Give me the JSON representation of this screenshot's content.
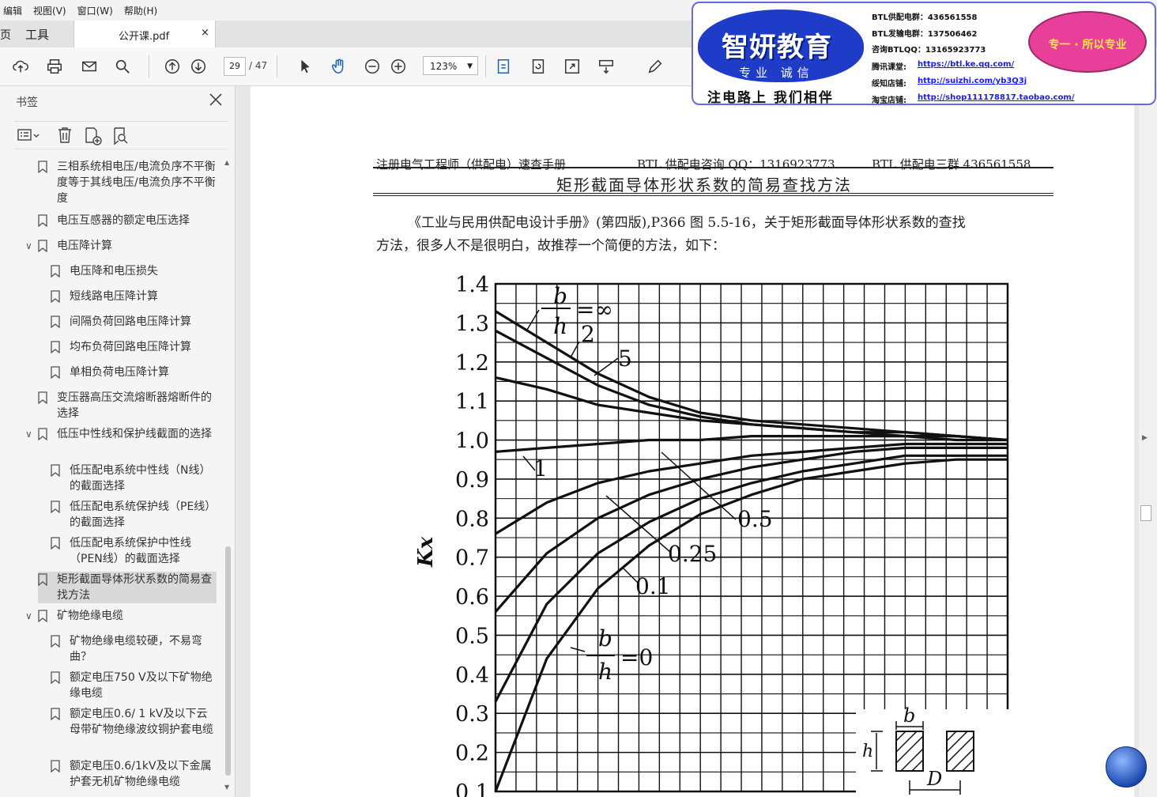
{
  "menu": [
    "编辑",
    "视图(V)",
    "窗口(W)",
    "帮助(H)"
  ],
  "tabs": {
    "cut_label": "页",
    "tools_label": "工具",
    "file_name": "公开课.pdf",
    "close_glyph": "×"
  },
  "toolbar": {
    "page_current": "29",
    "page_total": "/ 47",
    "zoom": "123%",
    "icons": [
      "upload-icon",
      "print-icon",
      "mail-icon",
      "search-icon",
      "page-up-icon",
      "page-down-icon",
      "select-cursor-icon",
      "hand-tool-icon",
      "zoom-out-icon",
      "zoom-in-icon",
      "fit-page-icon",
      "rotate-icon",
      "fullscreen-icon",
      "read-mode-icon",
      "pen-icon"
    ]
  },
  "sidebar": {
    "title": "书签",
    "bookmarks": [
      {
        "label": "三相系统相电压/电流负序不平衡度等于其线电压/电流负序不平衡度",
        "level": 1,
        "expand": ""
      },
      {
        "label": "电压互感器的额定电压选择",
        "level": 1,
        "expand": ""
      },
      {
        "label": "电压降计算",
        "level": 1,
        "expand": "∨"
      },
      {
        "label": "电压降和电压损失",
        "level": 2,
        "expand": ""
      },
      {
        "label": "短线路电压降计算",
        "level": 2,
        "expand": ""
      },
      {
        "label": "间隔负荷回路电压降计算",
        "level": 2,
        "expand": ""
      },
      {
        "label": "均布负荷回路电压降计算",
        "level": 2,
        "expand": ""
      },
      {
        "label": "单相负荷电压降计算",
        "level": 2,
        "expand": ""
      },
      {
        "label": "变压器高压交流熔断器熔断件的选择",
        "level": 1,
        "expand": ""
      },
      {
        "label": "低压中性线和保护线截面的选择",
        "level": 1,
        "expand": "∨"
      },
      {
        "label": "低压配电系统中性线（N线）的截面选择",
        "level": 2,
        "expand": ""
      },
      {
        "label": "低压配电系统保护线（PE线）的截面选择",
        "level": 2,
        "expand": ""
      },
      {
        "label": "低压配电系统保护中性线（PEN线）的截面选择",
        "level": 2,
        "expand": ""
      },
      {
        "label": "矩形截面导体形状系数的简易查找方法",
        "level": 1,
        "expand": "",
        "selected": true
      },
      {
        "label": "矿物绝缘电缆",
        "level": 1,
        "expand": "∨"
      },
      {
        "label": "矿物绝缘电缆较硬，不易弯曲？",
        "level": 2,
        "expand": ""
      },
      {
        "label": "额定电压750 V及以下矿物绝缘电缆",
        "level": 2,
        "expand": ""
      },
      {
        "label": "额定电压0.6/ 1 kV及以下云母带矿物绝缘波纹铜护套电缆",
        "level": 2,
        "expand": ""
      },
      {
        "label": "额定电压0.6/1kV及以下金属护套无机矿物绝缘电缆",
        "level": 2,
        "expand": ""
      }
    ]
  },
  "document": {
    "header_left": "注册电气工程师（供配电）速查手册",
    "header_mid": "BTL 供配电咨询 QQ：1316923773",
    "header_right": "BTL 供配电三群 436561558",
    "title": "矩形截面导体形状系数的简易查找方法",
    "para_line1": "《工业与民用供配电设计手册》(第四版),P366 图 5.5-16，关于矩形截面导体形状系数的查找",
    "para_line2": "方法，很多人不是很明白，故推荐一个简便的方法，如下："
  },
  "chart_data": {
    "type": "line",
    "ylabel": "Kx",
    "ylim": [
      0.1,
      1.4
    ],
    "yticks": [
      "1.4",
      "1.3",
      "1.2",
      "1.1",
      "1.0",
      "0.9",
      "0.8",
      "0.7",
      "0.6",
      "0.5",
      "0.4",
      "0.3",
      "0.2",
      "0.1"
    ],
    "grid": true,
    "series": [
      {
        "name": "∞",
        "values": [
          1.33,
          1.25,
          1.17,
          1.11,
          1.07,
          1.05,
          1.04,
          1.03,
          1.02,
          1.01,
          1.0
        ]
      },
      {
        "name": "2",
        "values": [
          1.28,
          1.21,
          1.14,
          1.09,
          1.06,
          1.04,
          1.03,
          1.02,
          1.02,
          1.01,
          1.0
        ]
      },
      {
        "name": "5",
        "values": [
          1.16,
          1.13,
          1.09,
          1.07,
          1.05,
          1.04,
          1.03,
          1.02,
          1.01,
          1.01,
          1.0
        ]
      },
      {
        "name": "1",
        "values": [
          0.97,
          0.98,
          0.99,
          1.0,
          1.0,
          1.01,
          1.01,
          1.01,
          1.01,
          1.0,
          1.0
        ]
      },
      {
        "name": "0.5",
        "values": [
          0.76,
          0.84,
          0.89,
          0.92,
          0.94,
          0.96,
          0.97,
          0.98,
          0.99,
          0.99,
          0.99
        ]
      },
      {
        "name": "0.25",
        "values": [
          0.56,
          0.71,
          0.8,
          0.86,
          0.9,
          0.93,
          0.95,
          0.97,
          0.98,
          0.98,
          0.98
        ]
      },
      {
        "name": "0.1",
        "values": [
          0.33,
          0.58,
          0.71,
          0.79,
          0.85,
          0.89,
          0.92,
          0.94,
          0.96,
          0.96,
          0.96
        ]
      },
      {
        "name": "0",
        "values": [
          0.1,
          0.44,
          0.62,
          0.73,
          0.81,
          0.86,
          0.9,
          0.92,
          0.94,
          0.95,
          0.95
        ]
      }
    ],
    "annotations": [
      "b",
      "h",
      "=∞",
      "2",
      "5",
      "1",
      "0.5",
      "0.25",
      "0.1",
      "b",
      "h",
      "=0",
      "b",
      "h",
      "D"
    ]
  },
  "ad": {
    "logo": "智妍教育",
    "sub": "专业 诚信",
    "slogan": "注电路上  我们相伴",
    "lines": [
      "BTL供配电群：436561558",
      "BTL发输电群：137506462",
      "咨询BTLQQ：13165923773",
      "腾讯课堂:",
      "绥知店铺:",
      "淘宝店铺:"
    ],
    "links": [
      "https://btl.ke.qq.com/",
      "http://suizhi.com/yb3Q3j",
      "http://shop111178817.taobao.com/"
    ],
    "badge": "专一 · 所以专业"
  },
  "colors": {
    "accent": "#1f3cc9",
    "selected_bg": "#d9d9d9",
    "badge": "#e8409a"
  }
}
